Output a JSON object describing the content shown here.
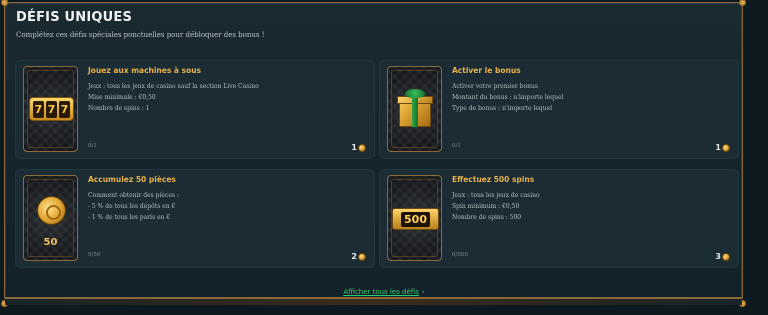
{
  "header": {
    "title": "DÉFIS UNIQUES",
    "subtitle": "Complétez ces défis spéciales ponctuelles pour débloquer des bonus !"
  },
  "cards": [
    {
      "title": "Jouez aux machines à sous",
      "lines": [
        "Jeux : tous les jeux de casino sauf la section Live Casino",
        "Mise minimale : €0,50",
        "Nombre de spins : 1"
      ],
      "progress": "0/1",
      "reward": "1",
      "icon": "slot-machine-777-icon"
    },
    {
      "title": "Activer le bonus",
      "lines": [
        "Activer votre premier bonus",
        "Montant du bonus : n'importe lequel",
        "Type de bonus : n'importe lequel"
      ],
      "progress": "0/1",
      "reward": "1",
      "icon": "gift-box-icon"
    },
    {
      "title": "Accumulez 50 pièces",
      "lines": [
        "Comment obtenir des pièces :",
        "- 5 % de tous les dépôts en €",
        "- 1 % de tous les paris en €"
      ],
      "progress": "0/50",
      "reward": "2",
      "icon": "coin-medal-icon",
      "thumb_label": "50"
    },
    {
      "title": "Effectuez 500 spins",
      "lines": [
        "Jeux : tous les jeux de casino",
        "Spin minimum : €0,50",
        "Nombre de spins : 500"
      ],
      "progress": "0/500",
      "reward": "3",
      "icon": "500-sign-icon",
      "thumb_label": "500"
    }
  ],
  "slot_digits": [
    "7",
    "7",
    "7"
  ],
  "footer": {
    "show_all_label": "Afficher tous les défis",
    "chevron": "›"
  }
}
